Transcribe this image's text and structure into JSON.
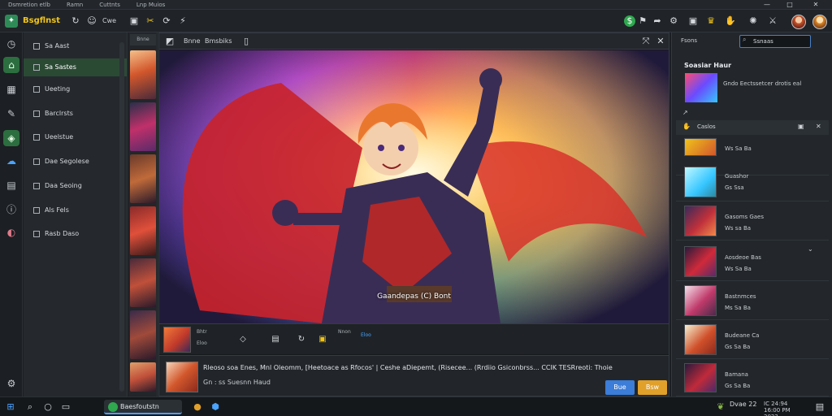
{
  "titlebar": {
    "app_name": "Dsmretion etlb",
    "tabs": [
      "Ramn",
      "Cuttnts",
      "Lnp Muios"
    ],
    "controls": [
      "—",
      "□",
      "✕"
    ]
  },
  "toolbar": {
    "brand": "Bsgflnst",
    "tab_label": "Cwe",
    "icons": [
      "refresh-icon",
      "person-icon",
      "pin-icon",
      "star-icon",
      "scissors-icon",
      "bolt-icon"
    ],
    "right_icons": [
      "coin-icon",
      "settings-icon",
      "bell-icon",
      "crown-icon"
    ]
  },
  "rail": {
    "icons": [
      {
        "name": "clock-icon",
        "glyph": "◷"
      },
      {
        "name": "home-icon",
        "glyph": "⌂"
      },
      {
        "name": "grid-icon",
        "glyph": "▦"
      },
      {
        "name": "pen-icon",
        "glyph": "✎"
      },
      {
        "name": "layers-icon",
        "glyph": "◈"
      },
      {
        "name": "cloud-icon",
        "glyph": "☁"
      },
      {
        "name": "book-icon",
        "glyph": "▤"
      },
      {
        "name": "info-icon",
        "glyph": "ⓘ"
      },
      {
        "name": "palette-icon",
        "glyph": "◐"
      },
      {
        "name": "settings-icon",
        "glyph": "⚙"
      }
    ]
  },
  "nav": {
    "items": [
      {
        "label": "Sa Aast",
        "selected": false
      },
      {
        "label": "Sa Sastes",
        "selected": true
      },
      {
        "label": "Ueeting",
        "selected": false
      },
      {
        "label": "Barclrsts",
        "selected": false
      },
      {
        "label": "Ueelstue",
        "selected": false
      },
      {
        "label": "Dae Segolese",
        "selected": false
      },
      {
        "label": "Daa Seoing",
        "selected": false
      },
      {
        "label": "Als Fels",
        "selected": false
      },
      {
        "label": "Rasb Daso",
        "selected": false
      }
    ]
  },
  "strip": {
    "header": "Bnne"
  },
  "viewer": {
    "title": "Bnne",
    "subtitle": "Bmsbiks",
    "caption": "Gaandepas (C) Bont",
    "info_labels": [
      "Bhtr",
      "Eloo",
      "Nnon",
      "Eloo"
    ],
    "footer_text": "Rleoso soa Enes, Mnl Oleomm, [Heetoace as Rfocos' | Ceshe aDiepemt, (Risecee... (Rrdiio Gsiconbrss... CCIK TESRreoti: Thoie",
    "footer_sub": "Gn : ss Suesnn Haud",
    "btn_primary": "Bue",
    "btn_secondary": "Bsw"
  },
  "rpanel": {
    "search_label": "Fsons",
    "search_value": "Ssnaas",
    "card_title": "Soasiar Haur",
    "card_desc": "Gndo Eectssetcer drotis eal",
    "list_header": "Caslos",
    "rows": [
      {
        "title": "",
        "meta": "Ws Sa Ba"
      },
      {
        "title": "Guashor",
        "meta": "Gs Ssa"
      },
      {
        "title": "Gasoms Gaes",
        "meta": "Ws sa Ba"
      },
      {
        "title": "Aosdeoe Bas",
        "meta": "Ws Sa Ba"
      },
      {
        "title": "Bastnmces",
        "meta": "Ms Sa Ba"
      },
      {
        "title": "Budeane Ca",
        "meta": "Gs Sa Ba"
      },
      {
        "title": "Bamana",
        "meta": "Gs Sa Ba"
      }
    ]
  },
  "taskbar": {
    "app_label": "Baesfoutstn",
    "time": "Dvae 22",
    "date": "IC 24:94 16:00 PM 2022"
  }
}
